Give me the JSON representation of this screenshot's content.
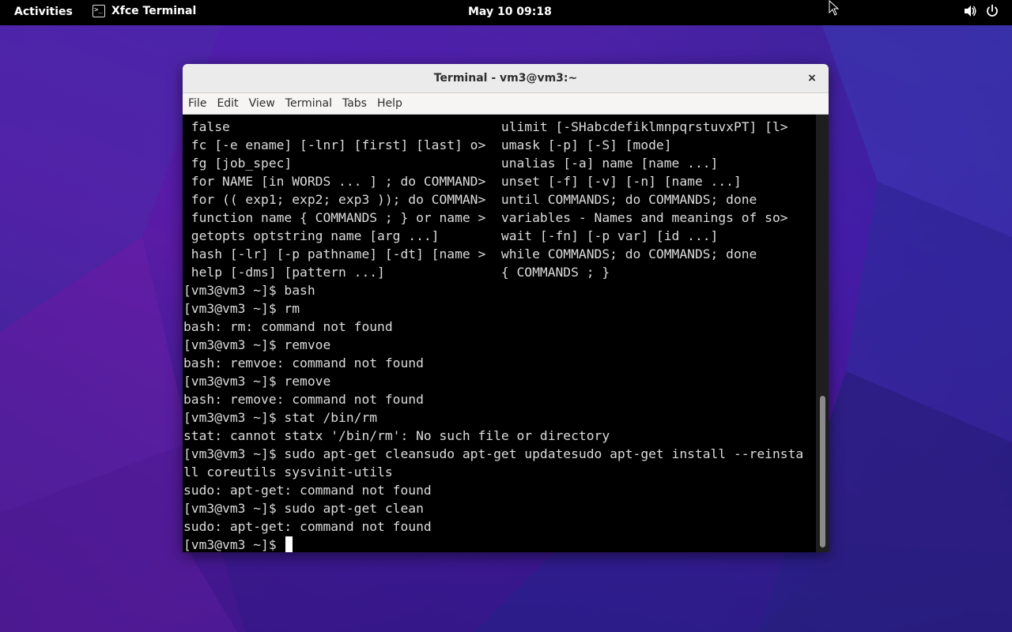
{
  "topbar": {
    "activities": "Activities",
    "app_label": "Xfce Terminal",
    "app_icon": "terminal-icon",
    "clock": "May 10  09:18",
    "tray_icons": [
      "volume-icon",
      "power-icon"
    ]
  },
  "window": {
    "title": "Terminal - vm3@vm3:~",
    "close_label": "×",
    "menu": [
      "File",
      "Edit",
      "View",
      "Terminal",
      "Tabs",
      "Help"
    ]
  },
  "terminal": {
    "lines": [
      " false                                   ulimit [-SHabcdefiklmnpqrstuvxPT] [l>",
      " fc [-e ename] [-lnr] [first] [last] o>  umask [-p] [-S] [mode]",
      " fg [job_spec]                           unalias [-a] name [name ...]",
      " for NAME [in WORDS ... ] ; do COMMAND>  unset [-f] [-v] [-n] [name ...]",
      " for (( exp1; exp2; exp3 )); do COMMAN>  until COMMANDS; do COMMANDS; done",
      " function name { COMMANDS ; } or name >  variables - Names and meanings of so>",
      " getopts optstring name [arg ...]        wait [-fn] [-p var] [id ...]",
      " hash [-lr] [-p pathname] [-dt] [name >  while COMMANDS; do COMMANDS; done",
      " help [-dms] [pattern ...]               { COMMANDS ; }",
      "[vm3@vm3 ~]$ bash",
      "[vm3@vm3 ~]$ rm",
      "bash: rm: command not found",
      "[vm3@vm3 ~]$ remvoe",
      "bash: remvoe: command not found",
      "[vm3@vm3 ~]$ remove",
      "bash: remove: command not found",
      "[vm3@vm3 ~]$ stat /bin/rm",
      "stat: cannot statx '/bin/rm': No such file or directory",
      "[vm3@vm3 ~]$ sudo apt-get cleansudo apt-get updatesudo apt-get install --reinsta",
      "ll coreutils sysvinit-utils",
      "sudo: apt-get: command not found",
      "[vm3@vm3 ~]$ sudo apt-get clean",
      "sudo: apt-get: command not found"
    ],
    "prompt": "[vm3@vm3 ~]$ ",
    "colors": {
      "background": "#000000",
      "foreground": "#dcdcdc"
    }
  }
}
